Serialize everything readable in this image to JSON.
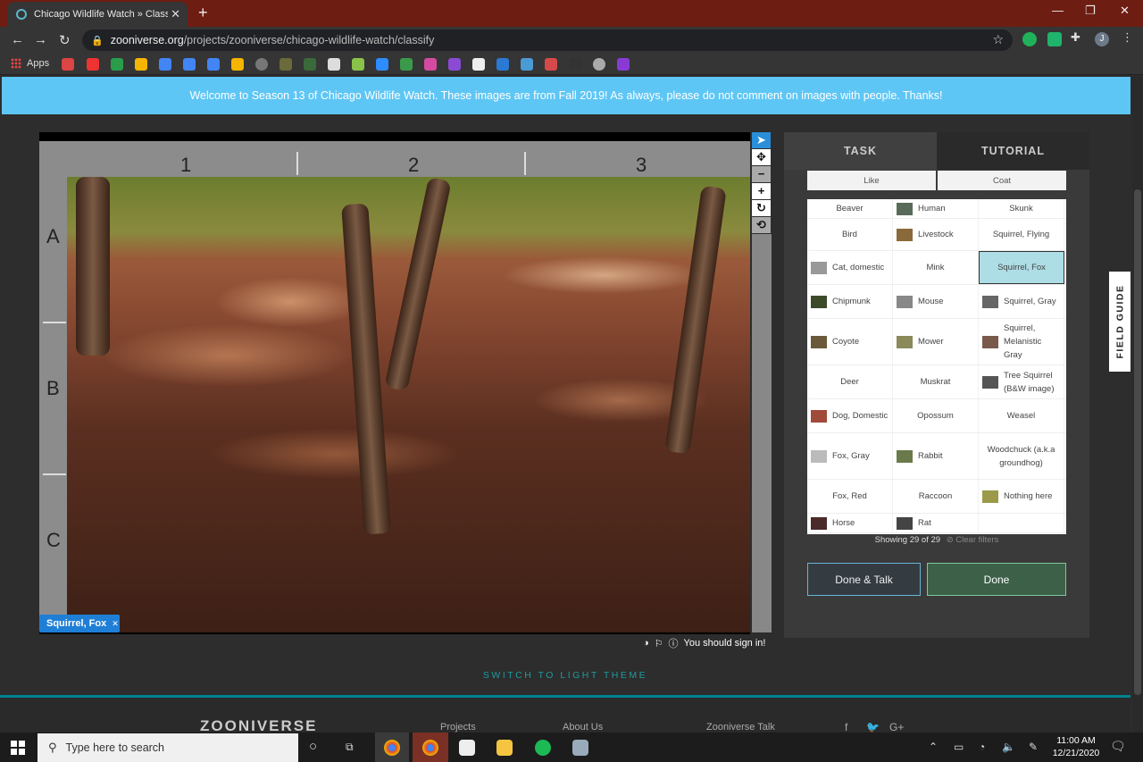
{
  "browser": {
    "tab_title": "Chicago Wildlife Watch » Classify",
    "new_tab": "+",
    "url_host": "zooniverse.org",
    "url_path": "/projects/zooniverse/chicago-wildlife-watch/classify",
    "bookmarks_apps": "Apps",
    "profile_initial": "J"
  },
  "banner": "Welcome to Season 13 of Chicago Wildlife Watch. These images are from Fall 2019! As always, please do not comment on images with people. Thanks!",
  "viewer": {
    "columns": [
      "1",
      "2",
      "3"
    ],
    "rows": [
      "A",
      "B",
      "C"
    ],
    "tag": "Squirrel, Fox",
    "signin": "You should sign in!"
  },
  "panel": {
    "tabs": [
      "TASK",
      "TUTORIAL"
    ],
    "filters": [
      "Like",
      "Coat"
    ],
    "choices": [
      [
        {
          "label": "Beaver",
          "img": false
        },
        {
          "label": "Human",
          "img": true,
          "color": "#5a6a5a"
        },
        {
          "label": "Skunk",
          "img": false
        }
      ],
      [
        {
          "label": "Bird",
          "img": false
        },
        {
          "label": "Livestock",
          "img": true,
          "color": "#8a6a3a"
        },
        {
          "label": "Squirrel, Flying",
          "img": false
        }
      ],
      [
        {
          "label": "Cat, domestic",
          "img": true,
          "color": "#999"
        },
        {
          "label": "Mink",
          "img": false
        },
        {
          "label": "Squirrel, Fox",
          "img": false,
          "selected": true
        }
      ],
      [
        {
          "label": "Chipmunk",
          "img": true,
          "color": "#3c4a2a"
        },
        {
          "label": "Mouse",
          "img": true,
          "color": "#888"
        },
        {
          "label": "Squirrel, Gray",
          "img": true,
          "color": "#666"
        }
      ],
      [
        {
          "label": "Coyote",
          "img": true,
          "color": "#6a5a3a"
        },
        {
          "label": "Mower",
          "img": true,
          "color": "#8a8a5a"
        },
        {
          "label": "Squirrel, Melanistic Gray",
          "img": true,
          "color": "#7a5a4a"
        }
      ],
      [
        {
          "label": "Deer",
          "img": false
        },
        {
          "label": "Muskrat",
          "img": false
        },
        {
          "label": "Tree Squirrel (B&W image)",
          "img": true,
          "color": "#555"
        }
      ],
      [
        {
          "label": "Dog, Domestic",
          "img": true,
          "color": "#a04a3a"
        },
        {
          "label": "Opossum",
          "img": false
        },
        {
          "label": "Weasel",
          "img": false
        }
      ],
      [
        {
          "label": "Fox, Gray",
          "img": true,
          "color": "#bbb"
        },
        {
          "label": "Rabbit",
          "img": true,
          "color": "#6a7a4a"
        },
        {
          "label": "Woodchuck (a.k.a groundhog)",
          "img": false
        }
      ],
      [
        {
          "label": "Fox, Red",
          "img": false
        },
        {
          "label": "Raccoon",
          "img": false
        },
        {
          "label": "Nothing here",
          "img": true,
          "color": "#9a9a4a"
        }
      ],
      [
        {
          "label": "Horse",
          "img": true,
          "color": "#4a2a2a"
        },
        {
          "label": "Rat",
          "img": true,
          "color": "#444"
        },
        {
          "label": "",
          "img": false
        }
      ]
    ],
    "showing": "Showing 29 of 29",
    "clear_filters": "⊘ Clear filters",
    "done_talk": "Done & Talk",
    "done": "Done",
    "field_guide": "FIELD GUIDE"
  },
  "footer": {
    "switch_theme": "SWITCH TO LIGHT THEME",
    "logo": "ZOONIVERSE",
    "links": [
      "Projects",
      "About Us",
      "Zooniverse Talk"
    ],
    "social": [
      "f",
      "🐦",
      "G+"
    ]
  },
  "taskbar": {
    "search_placeholder": "Type here to search",
    "time": "11:00 AM",
    "date": "12/21/2020"
  }
}
